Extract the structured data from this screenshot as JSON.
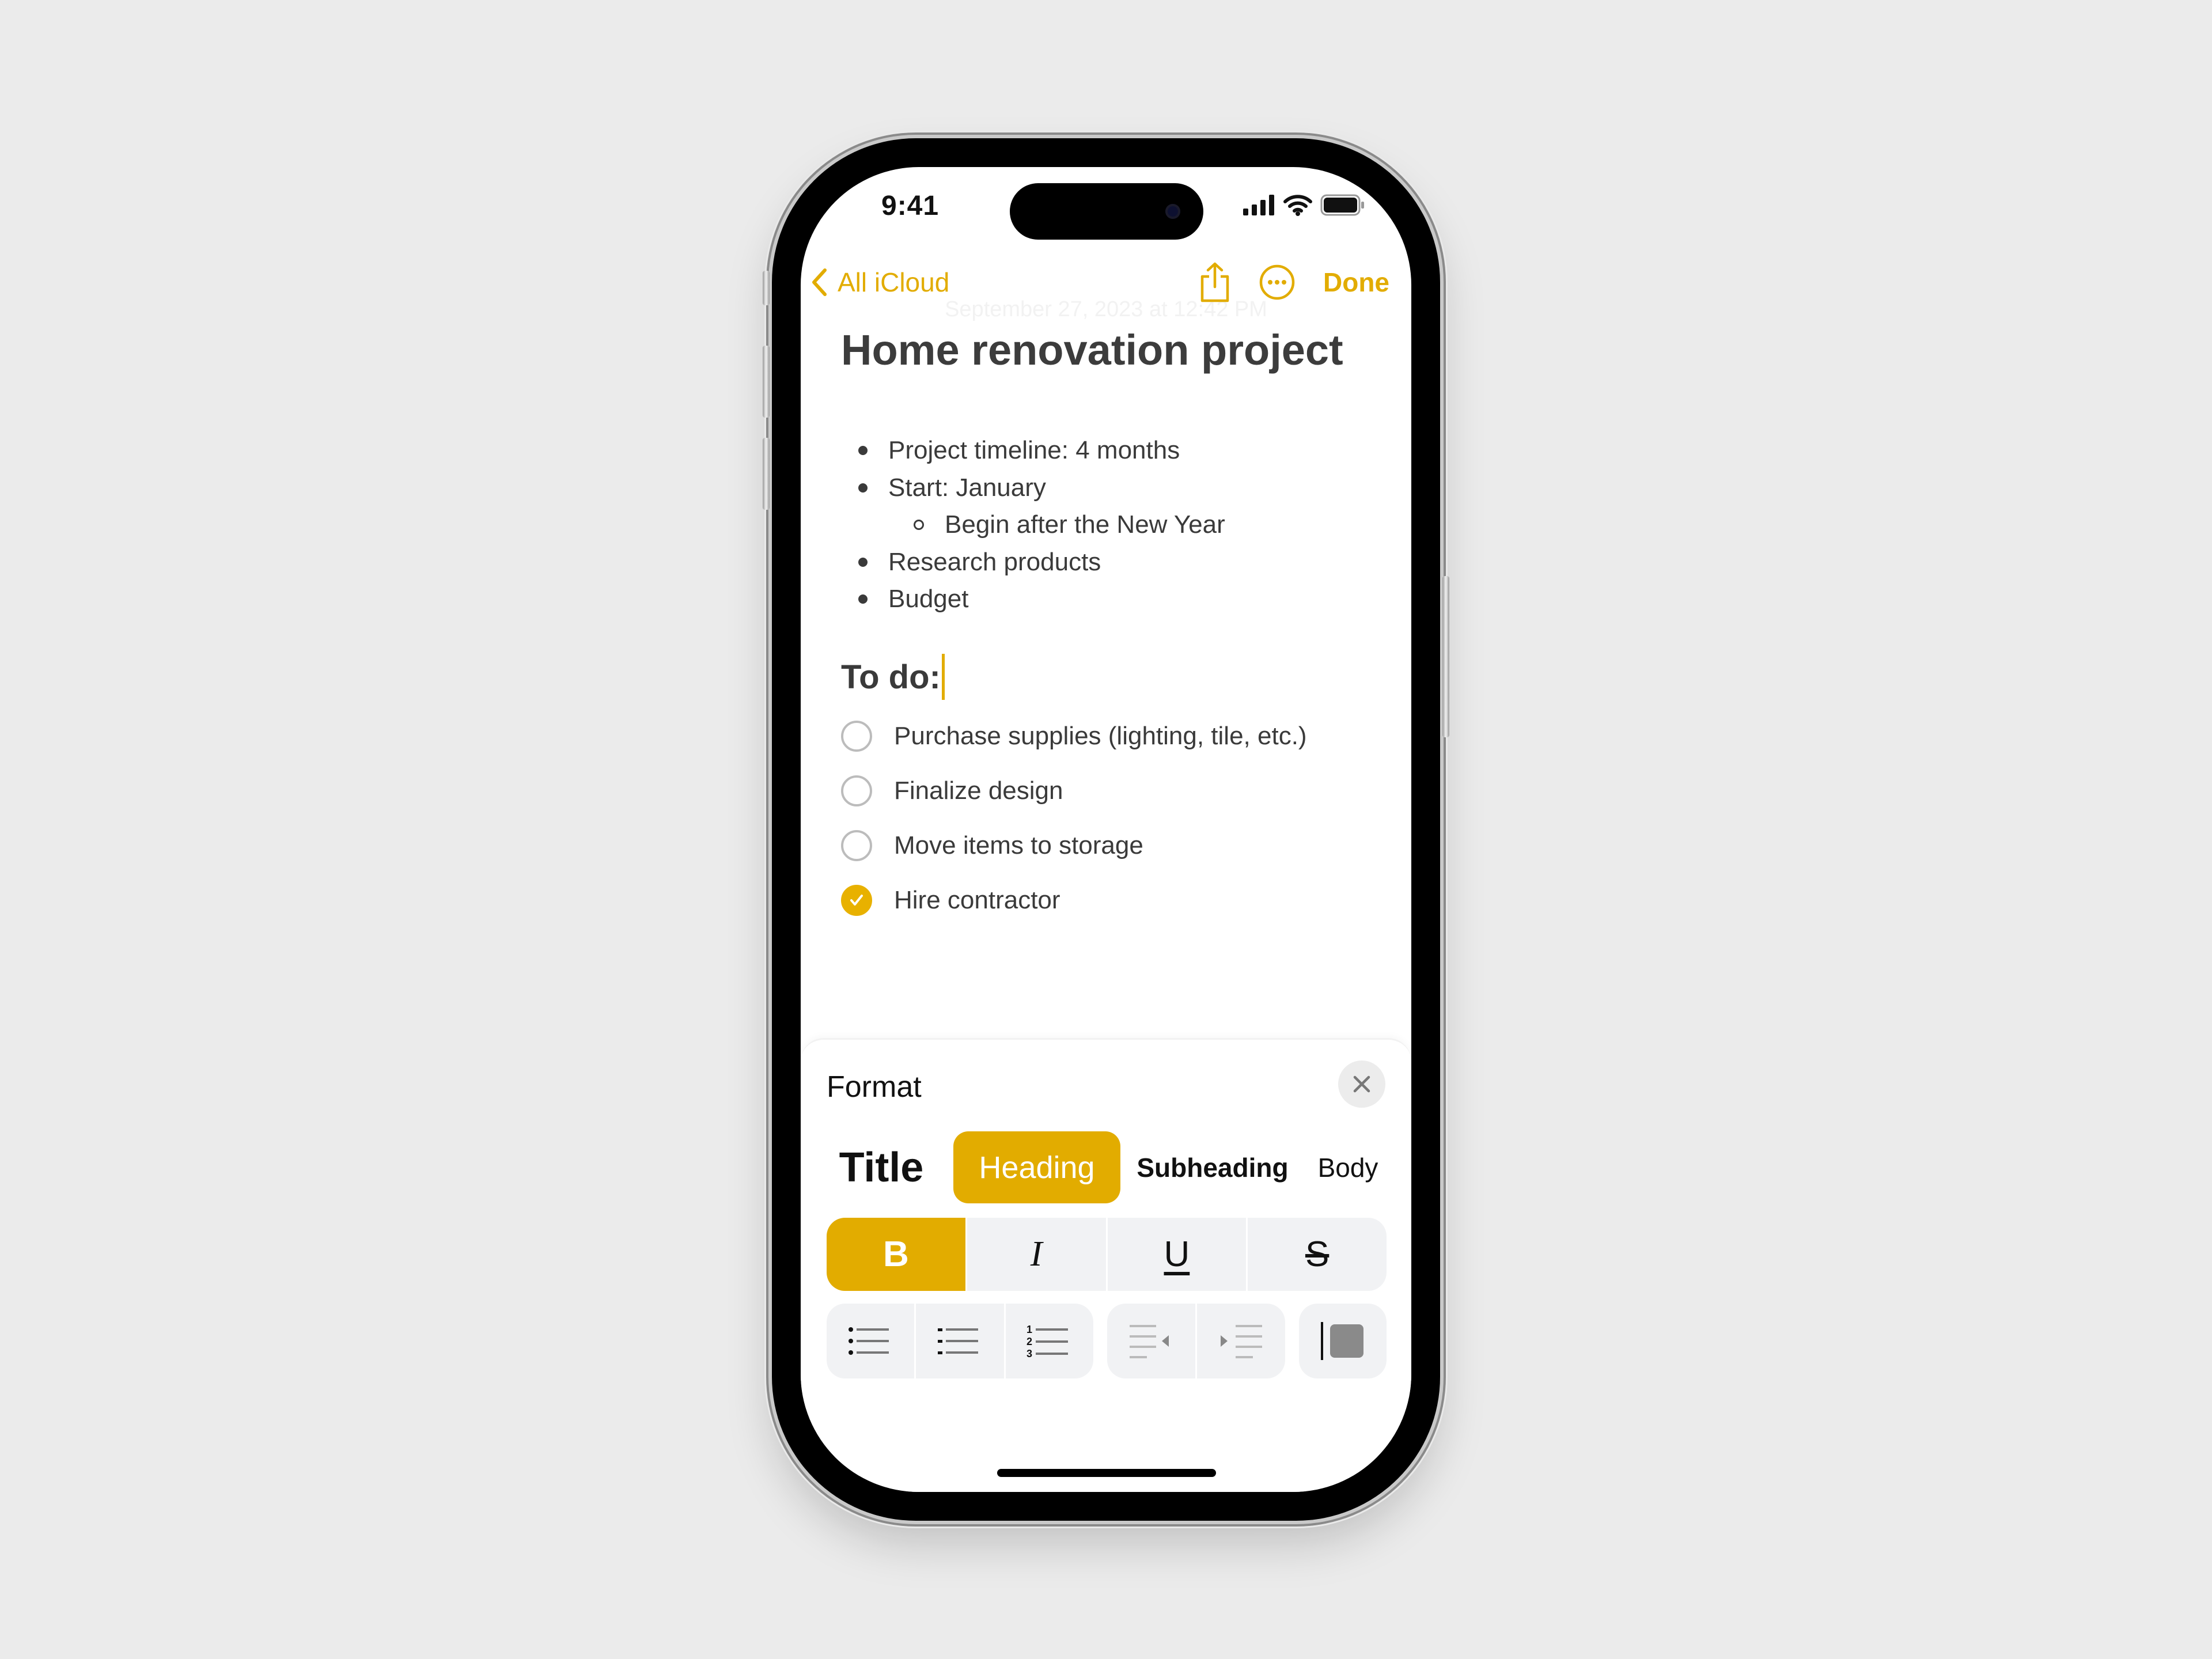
{
  "status_bar": {
    "time": "9:41",
    "signal_icon": "cellular-signal-icon",
    "wifi_icon": "wifi-icon",
    "battery_icon": "battery-icon"
  },
  "nav": {
    "back_label": "All iCloud",
    "back_icon": "chevron-left-icon",
    "date": "September 27, 2023 at 12:42 PM",
    "share_icon": "share-icon",
    "more_icon": "ellipsis-circle-icon",
    "done_label": "Done"
  },
  "note": {
    "title": "Home renovation project",
    "bullets": [
      {
        "text": "Project timeline: 4 months",
        "level": 1
      },
      {
        "text": "Start: January",
        "level": 1
      },
      {
        "text": "Begin after the New Year",
        "level": 2
      },
      {
        "text": "Research products",
        "level": 1
      },
      {
        "text": "Budget",
        "level": 1
      }
    ],
    "todo_heading": "To do:",
    "checklist": [
      {
        "text": "Purchase supplies (lighting, tile, etc.)",
        "checked": false
      },
      {
        "text": "Finalize design",
        "checked": false
      },
      {
        "text": "Move items to storage",
        "checked": false
      },
      {
        "text": "Hire contractor",
        "checked": true
      }
    ]
  },
  "format_sheet": {
    "title": "Format",
    "close_icon": "close-icon",
    "styles": [
      "Title",
      "Heading",
      "Subheading",
      "Body"
    ],
    "selected_style": "Heading",
    "text_styles": [
      {
        "label": "B",
        "name": "bold",
        "active": true
      },
      {
        "label": "I",
        "name": "italic",
        "active": false
      },
      {
        "label": "U",
        "name": "underline",
        "active": false
      },
      {
        "label": "S",
        "name": "strikethrough",
        "active": false
      }
    ],
    "list_buttons": [
      "bulleted-list-icon",
      "dashed-list-icon",
      "numbered-list-icon"
    ],
    "indent_buttons": [
      "outdent-icon",
      "indent-icon"
    ],
    "block_quote_icon": "block-quote-icon",
    "numbered_list_digits": [
      "1",
      "2",
      "3"
    ]
  },
  "colors": {
    "accent": "#e2ac00",
    "text": "#3a3a3a",
    "button_bg": "#f1f2f4"
  }
}
